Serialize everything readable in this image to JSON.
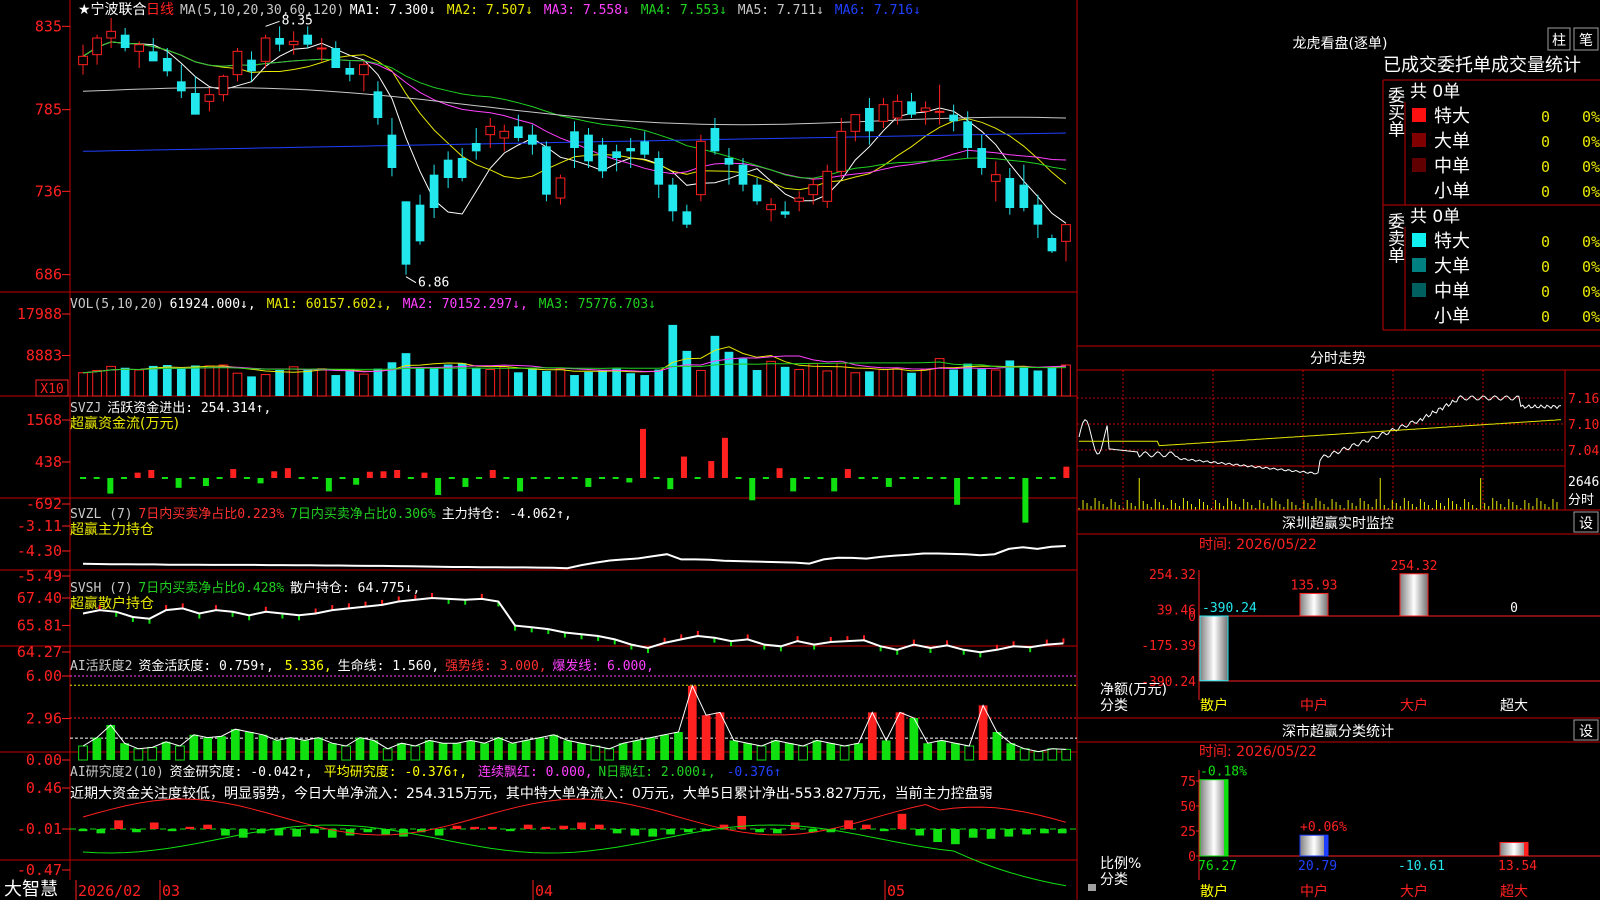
{
  "stock": {
    "name": "★宁波联合",
    "period": "日线"
  },
  "colors": {
    "up": "#ff2020",
    "down": "#22e8ee",
    "bg": "#000000",
    "grid": "#c00000",
    "white": "#ffffff",
    "yellow": "#e8e800",
    "magenta": "#ff40ff",
    "green": "#20d020",
    "blue": "#2040ff",
    "vgreen": "#10e010",
    "gray": "#a0a0a0"
  },
  "main": {
    "legend": [
      {
        "text": "MA(5,10,20,30,60,120)",
        "color": "#c8c8c8"
      },
      {
        "text": "MA1: 7.300↓",
        "color": "#ffffff"
      },
      {
        "text": "MA2: 7.507↓",
        "color": "#e8e800"
      },
      {
        "text": "MA3: 7.558↓",
        "color": "#ff40ff"
      },
      {
        "text": "MA4: 7.553↓",
        "color": "#20d020"
      },
      {
        "text": "MA5: 7.711↓",
        "color": "#c8c8c8"
      },
      {
        "text": "MA6: 7.716↓",
        "color": "#2040ff"
      }
    ],
    "yticks": [
      "835",
      "785",
      "736",
      "686"
    ],
    "high_label": "8.35",
    "low_label": "6.86"
  },
  "vol": {
    "legend": [
      {
        "text": "VOL(5,10,20)",
        "color": "#c8c8c8"
      },
      {
        "text": "61924.000↓,",
        "color": "#ffffff"
      },
      {
        "text": "MA1: 60157.602↓,",
        "color": "#e8e800"
      },
      {
        "text": "MA2: 70152.297↓,",
        "color": "#ff40ff"
      },
      {
        "text": "MA3: 75776.703↓",
        "color": "#20d020"
      }
    ],
    "yticks": [
      "17988",
      "8883"
    ],
    "unit": "X10"
  },
  "svzj": {
    "legend": [
      {
        "text": "SVZJ",
        "color": "#c8c8c8"
      },
      {
        "text": "活跃资金进出: 254.314↑,",
        "color": "#ffffff"
      }
    ],
    "subtitle": "超赢资金流(万元)",
    "yticks": [
      "1568",
      "438",
      "-692"
    ]
  },
  "svzl": {
    "legend": [
      {
        "text": "SVZL (7)",
        "color": "#c8c8c8"
      },
      {
        "text": "7日内买卖净占比0.223%",
        "color": "#ff3030"
      },
      {
        "text": "7日内买卖净占比0.306%",
        "color": "#20d020"
      },
      {
        "text": "主力持仓: -4.062↑,",
        "color": "#ffffff"
      }
    ],
    "subtitle": "超赢主力持仓",
    "yticks": [
      "-3.11",
      "-4.30",
      "-5.49"
    ]
  },
  "svsh": {
    "legend": [
      {
        "text": "SVSH (7)",
        "color": "#c8c8c8"
      },
      {
        "text": "7日内买卖净占比0.428%",
        "color": "#20d020"
      },
      {
        "text": "散户持仓: 64.775↓,",
        "color": "#ffffff"
      }
    ],
    "subtitle": "超赢散户持仓",
    "yticks": [
      "67.40",
      "65.81",
      "64.27"
    ]
  },
  "ai1": {
    "legend": [
      {
        "text": "AI活跃度2",
        "color": "#c8c8c8"
      },
      {
        "text": "资金活跃度: 0.759↑,",
        "color": "#ffffff"
      },
      {
        "text": "5.336,",
        "color": "#ffff00"
      },
      {
        "text": "生命线: 1.560,",
        "color": "#ffffff"
      },
      {
        "text": "强势线: 3.000,",
        "color": "#ff3030"
      },
      {
        "text": "爆发线: 6.000,",
        "color": "#ff40ff"
      }
    ],
    "yticks": [
      "6.00",
      "2.96",
      "0.00"
    ]
  },
  "ai2": {
    "legend": [
      {
        "text": "AI研究度2(10)",
        "color": "#c8c8c8"
      },
      {
        "text": "资金研究度: -0.042↑,",
        "color": "#ffffff"
      },
      {
        "text": "平均研究度: -0.376↑,",
        "color": "#ffff00"
      },
      {
        "text": "连续飘红: 0.000,",
        "color": "#ff40ff"
      },
      {
        "text": "N日飘红: 2.000↓,",
        "color": "#20d020"
      },
      {
        "text": "-0.376↑",
        "color": "#2040ff"
      }
    ],
    "comment": "近期大资金关注度较低，明显弱势，今日大单净流入：254.315万元，其中特大单净流入：0万元，大单5日累计净出-553.827万元，当前主力控盘弱",
    "yticks": [
      "0.46",
      "-0.01",
      "-0.47"
    ]
  },
  "xaxis": {
    "logo": "大智慧",
    "labels": [
      "2026/02",
      "03",
      "04",
      "05"
    ]
  },
  "right": {
    "lhb": {
      "title": "龙虎看盘(逐单)",
      "btn1": "柱",
      "btn2": "笔",
      "table_title": "已成交委托单成交量统计",
      "buy_side": "委买单",
      "sell_side": "委卖单",
      "buy_total": "共 0单",
      "sell_total": "共 0单",
      "buy_rows": [
        {
          "name": "特大",
          "count": "0",
          "pct": "0%",
          "color": "#ff1010"
        },
        {
          "name": "大单",
          "count": "0",
          "pct": "0%",
          "color": "#800000"
        },
        {
          "name": "中单",
          "count": "0",
          "pct": "0%",
          "color": "#600000"
        },
        {
          "name": "小单",
          "count": "0",
          "pct": "0%",
          "color": ""
        }
      ],
      "sell_rows": [
        {
          "name": "特大",
          "count": "0",
          "pct": "0%",
          "color": "#10f0f0"
        },
        {
          "name": "大单",
          "count": "0",
          "pct": "0%",
          "color": "#008080"
        },
        {
          "name": "中单",
          "count": "0",
          "pct": "0%",
          "color": "#006060"
        },
        {
          "name": "小单",
          "count": "0",
          "pct": "0%",
          "color": ""
        }
      ]
    },
    "intraday": {
      "title": "分时走势",
      "prices": [
        "7.16",
        "7.10",
        "7.04"
      ],
      "vol_value": "2646",
      "vol_unit": "分时"
    },
    "monitor": {
      "title": "深圳超赢实时监控",
      "set": "设",
      "date": "时间: 2026/05/22",
      "yticks": [
        "254.32",
        "39.46",
        "0",
        "-175.39",
        "-390.24"
      ],
      "ylabel1": "净额(万元)",
      "ylabel2": "分类",
      "categories": [
        "散户",
        "中户",
        "大户",
        "超大"
      ],
      "values": [
        -390.24,
        135.93,
        254.32,
        0
      ],
      "value_labels": [
        "-390.24",
        "135.93",
        "254.32",
        "0"
      ]
    },
    "classify": {
      "title": "深市超赢分类统计",
      "set": "设",
      "date": "时间: 2026/05/22",
      "yticks": [
        "75",
        "50",
        "25",
        "0"
      ],
      "ylabel1": "比例%",
      "ylabel2": "分类",
      "categories": [
        "散户",
        "中户",
        "大户",
        "超大"
      ],
      "values": [
        76.27,
        20.79,
        -10.61,
        13.54
      ],
      "change_labels": [
        "-0.18%",
        "+0.06%",
        "",
        ""
      ]
    }
  },
  "chart_data": {
    "type": "candlestick",
    "candles": [
      [
        8.12,
        8.24,
        8.06,
        8.17
      ],
      [
        8.18,
        8.3,
        8.12,
        8.28
      ],
      [
        8.28,
        8.4,
        8.22,
        8.32
      ],
      [
        8.3,
        8.34,
        8.2,
        8.22
      ],
      [
        8.2,
        8.26,
        8.1,
        8.24
      ],
      [
        8.2,
        8.28,
        8.14,
        8.14
      ],
      [
        8.16,
        8.22,
        8.05,
        8.08
      ],
      [
        8.02,
        8.12,
        7.92,
        7.96
      ],
      [
        7.95,
        8.05,
        7.86,
        7.82
      ],
      [
        7.9,
        7.98,
        7.84,
        7.94
      ],
      [
        7.94,
        8.06,
        7.9,
        8.05
      ],
      [
        8.06,
        8.22,
        8.02,
        8.2
      ],
      [
        8.15,
        8.2,
        8.02,
        8.08
      ],
      [
        8.14,
        8.3,
        8.1,
        8.28
      ],
      [
        8.28,
        8.35,
        8.2,
        8.24
      ],
      [
        8.24,
        8.32,
        8.18,
        8.26
      ],
      [
        8.3,
        8.35,
        8.22,
        8.24
      ],
      [
        8.22,
        8.28,
        8.14,
        8.22
      ],
      [
        8.22,
        8.26,
        8.1,
        8.1
      ],
      [
        8.1,
        8.14,
        8.02,
        8.06
      ],
      [
        8.06,
        8.14,
        7.96,
        8.12
      ],
      [
        7.96,
        8.02,
        7.76,
        7.8
      ],
      [
        7.7,
        7.8,
        7.45,
        7.5
      ],
      [
        7.3,
        7.3,
        6.86,
        6.92
      ],
      [
        7.28,
        7.34,
        7.04,
        7.06
      ],
      [
        7.46,
        7.52,
        7.2,
        7.26
      ],
      [
        7.55,
        7.6,
        7.38,
        7.44
      ],
      [
        7.56,
        7.62,
        7.42,
        7.44
      ],
      [
        7.65,
        7.74,
        7.55,
        7.6
      ],
      [
        7.7,
        7.8,
        7.62,
        7.75
      ],
      [
        7.68,
        7.76,
        7.6,
        7.72
      ],
      [
        7.75,
        7.82,
        7.66,
        7.68
      ],
      [
        7.7,
        7.76,
        7.58,
        7.64
      ],
      [
        7.63,
        7.66,
        7.3,
        7.34
      ],
      [
        7.32,
        7.46,
        7.28,
        7.44
      ],
      [
        7.72,
        7.78,
        7.5,
        7.62
      ],
      [
        7.7,
        7.74,
        7.5,
        7.54
      ],
      [
        7.64,
        7.68,
        7.44,
        7.48
      ],
      [
        7.6,
        7.64,
        7.48,
        7.56
      ],
      [
        7.62,
        7.68,
        7.5,
        7.6
      ],
      [
        7.66,
        7.72,
        7.56,
        7.58
      ],
      [
        7.56,
        7.6,
        7.32,
        7.4
      ],
      [
        7.4,
        7.44,
        7.18,
        7.24
      ],
      [
        7.24,
        7.28,
        7.14,
        7.16
      ],
      [
        7.34,
        7.7,
        7.3,
        7.66
      ],
      [
        7.74,
        7.8,
        7.58,
        7.6
      ],
      [
        7.56,
        7.62,
        7.4,
        7.52
      ],
      [
        7.52,
        7.56,
        7.36,
        7.4
      ],
      [
        7.4,
        7.44,
        7.28,
        7.3
      ],
      [
        7.25,
        7.32,
        7.18,
        7.28
      ],
      [
        7.24,
        7.3,
        7.2,
        7.22
      ],
      [
        7.3,
        7.36,
        7.24,
        7.32
      ],
      [
        7.34,
        7.44,
        7.28,
        7.4
      ],
      [
        7.3,
        7.52,
        7.26,
        7.48
      ],
      [
        7.48,
        7.8,
        7.44,
        7.72
      ],
      [
        7.72,
        7.82,
        7.66,
        7.82
      ],
      [
        7.86,
        7.92,
        7.64,
        7.72
      ],
      [
        7.78,
        7.92,
        7.74,
        7.88
      ],
      [
        7.8,
        7.94,
        7.76,
        7.9
      ],
      [
        7.9,
        7.95,
        7.8,
        7.82
      ],
      [
        7.84,
        7.9,
        7.76,
        7.86
      ],
      [
        7.84,
        8.0,
        7.76,
        7.84
      ],
      [
        7.82,
        7.88,
        7.72,
        7.78
      ],
      [
        7.78,
        7.84,
        7.56,
        7.62
      ],
      [
        7.62,
        7.7,
        7.46,
        7.5
      ],
      [
        7.42,
        7.54,
        7.3,
        7.46
      ],
      [
        7.44,
        7.5,
        7.22,
        7.26
      ],
      [
        7.4,
        7.52,
        7.24,
        7.26
      ],
      [
        7.28,
        7.34,
        7.08,
        7.16
      ],
      [
        7.08,
        7.1,
        6.99,
        7.0
      ],
      [
        7.06,
        7.12,
        6.94,
        7.16
      ]
    ],
    "volume": [
      5100,
      5600,
      6500,
      6200,
      5700,
      6600,
      6800,
      6000,
      6700,
      6600,
      6800,
      5000,
      4300,
      4700,
      5700,
      6400,
      5800,
      6000,
      4600,
      5900,
      4800,
      6000,
      7400,
      9400,
      6300,
      6200,
      6900,
      7200,
      6200,
      5800,
      6400,
      5200,
      6000,
      5500,
      5900,
      4600,
      5300,
      5700,
      6000,
      5000,
      4600,
      5800,
      15600,
      9900,
      5600,
      13200,
      9700,
      8200,
      5700,
      7600,
      6400,
      5800,
      7100,
      5500,
      7200,
      5100,
      5400,
      5800,
      6100,
      5100,
      5800,
      8200,
      5800,
      7100,
      5900,
      5700,
      7800,
      6200,
      5600,
      6400,
      6800
    ],
    "svzj": [
      0,
      0,
      -350,
      0,
      120,
      180,
      0,
      -220,
      0,
      -180,
      0,
      200,
      0,
      -120,
      150,
      220,
      0,
      0,
      -300,
      0,
      -150,
      140,
      150,
      180,
      0,
      120,
      -380,
      0,
      -200,
      0,
      180,
      0,
      -300,
      0,
      0,
      0,
      0,
      -200,
      0,
      0,
      -100,
      1100,
      0,
      -250,
      480,
      0,
      380,
      900,
      0,
      -500,
      0,
      220,
      -300,
      0,
      0,
      -300,
      200,
      0,
      0,
      -200,
      0,
      0,
      0,
      0,
      -600,
      0,
      0,
      0,
      0,
      -1000,
      0,
      0,
      254
    ],
    "main_pos": [
      -4.91,
      -4.92,
      -4.93,
      -4.93,
      -4.94,
      -4.94,
      -4.95,
      -4.95,
      -4.95,
      -4.96,
      -4.96,
      -4.96,
      -4.96,
      -4.97,
      -4.97,
      -4.98,
      -4.98,
      -4.99,
      -4.99,
      -5.0,
      -5.01,
      -5.01,
      -5.02,
      -5.03,
      -5.04,
      -5.05,
      -5.06,
      -5.06,
      -5.07,
      -5.07,
      -5.08,
      -5.08,
      -5.09,
      -5.1,
      -5.12,
      -4.97,
      -4.85,
      -4.75,
      -4.7,
      -4.65,
      -4.55,
      -4.45,
      -4.7,
      -4.7,
      -4.72,
      -4.76,
      -4.78,
      -4.8,
      -4.82,
      -4.84,
      -4.85,
      -4.9,
      -4.7,
      -4.62,
      -4.63,
      -4.66,
      -4.58,
      -4.52,
      -4.48,
      -4.42,
      -4.42,
      -4.44,
      -4.45,
      -4.5,
      -4.45,
      -4.2,
      -4.12,
      -4.2,
      -4.1,
      -4.06
    ],
    "retail_pos": [
      66.5,
      66.7,
      66.6,
      66.3,
      66.2,
      66.7,
      66.8,
      66.5,
      66.7,
      66.6,
      66.4,
      66.6,
      66.5,
      66.4,
      66.5,
      66.7,
      66.8,
      66.9,
      67.0,
      67.2,
      67.3,
      67.4,
      67.35,
      67.3,
      67.35,
      67.2,
      65.8,
      65.7,
      65.6,
      65.4,
      65.3,
      65.2,
      65.0,
      64.7,
      64.5,
      64.8,
      65.0,
      65.2,
      65.1,
      64.9,
      65.0,
      64.7,
      64.6,
      64.9,
      64.7,
      64.85,
      64.9,
      64.95,
      64.6,
      64.4,
      64.7,
      64.5,
      64.65,
      64.4,
      64.25,
      64.4,
      64.6,
      64.55,
      64.7,
      64.77
    ],
    "ai_active": [
      1.0,
      1.6,
      2.5,
      1.2,
      0.8,
      0.9,
      1.3,
      1.0,
      1.8,
      1.6,
      1.7,
      2.2,
      2.0,
      1.8,
      1.4,
      1.6,
      1.4,
      1.6,
      1.2,
      1.0,
      1.6,
      1.4,
      0.8,
      1.2,
      1.0,
      1.4,
      1.2,
      1.2,
      1.4,
      1.2,
      1.6,
      1.2,
      1.4,
      1.6,
      1.8,
      1.4,
      1.2,
      1.0,
      0.8,
      1.2,
      1.4,
      1.6,
      1.8,
      2.0,
      5.3,
      3.2,
      3.4,
      1.4,
      1.2,
      1.0,
      1.4,
      1.2,
      1.0,
      1.4,
      1.2,
      1.0,
      1.2,
      3.4,
      1.4,
      3.4,
      3.0,
      1.2,
      1.4,
      1.2,
      1.0,
      3.9,
      2.0,
      1.2,
      0.8,
      0.6,
      0.8,
      0.759
    ],
    "ai_research": [
      -0.02,
      -0.04,
      0.08,
      -0.03,
      0.06,
      -0.02,
      0.02,
      0.04,
      -0.06,
      -0.08,
      -0.04,
      -0.06,
      -0.07,
      -0.04,
      -0.08,
      -0.06,
      -0.03,
      -0.05,
      -0.07,
      -0.03,
      -0.06,
      0.03,
      0.02,
      0.02,
      -0.02,
      0.04,
      0.02,
      0.03,
      0.06,
      0.04,
      -0.04,
      -0.06,
      -0.07,
      -0.05,
      -0.03,
      -0.02,
      0.04,
      0.12,
      -0.03,
      -0.04,
      0.06,
      -0.03,
      -0.03,
      0.08,
      0.04,
      -0.02,
      0.14,
      -0.06,
      -0.12,
      -0.14,
      -0.08,
      -0.09,
      -0.07,
      -0.05,
      -0.04,
      -0.04
    ]
  }
}
